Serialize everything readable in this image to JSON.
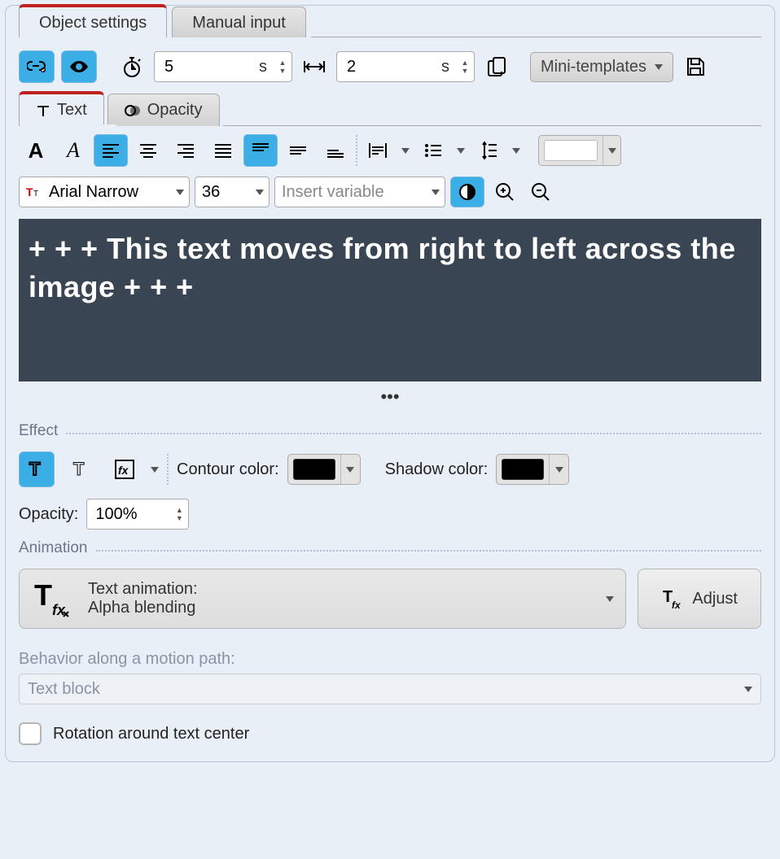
{
  "main_tabs": {
    "active": "Object settings",
    "other": "Manual input"
  },
  "toolbar": {
    "duration_value": "5",
    "duration_unit": "s",
    "offset_value": "2",
    "offset_unit": "s",
    "mini_templates": "Mini-templates"
  },
  "sub_tabs": {
    "text": "Text",
    "opacity": "Opacity"
  },
  "font": {
    "family": "Arial Narrow",
    "size": "36",
    "insert_variable_placeholder": "Insert variable"
  },
  "preview_text": "+ + + This text moves from right to left across the image + + +",
  "section_effect": "Effect",
  "effect": {
    "contour_label": "Contour color:",
    "shadow_label": "Shadow color:",
    "contour_color": "#000000",
    "shadow_color": "#000000",
    "opacity_label": "Opacity:",
    "opacity_value": "100%"
  },
  "section_animation": "Animation",
  "animation": {
    "label": "Text animation:",
    "value": "Alpha blending",
    "adjust": "Adjust"
  },
  "motion": {
    "label": "Behavior along a motion path:",
    "value": "Text block",
    "rotation_label": "Rotation around text center"
  }
}
